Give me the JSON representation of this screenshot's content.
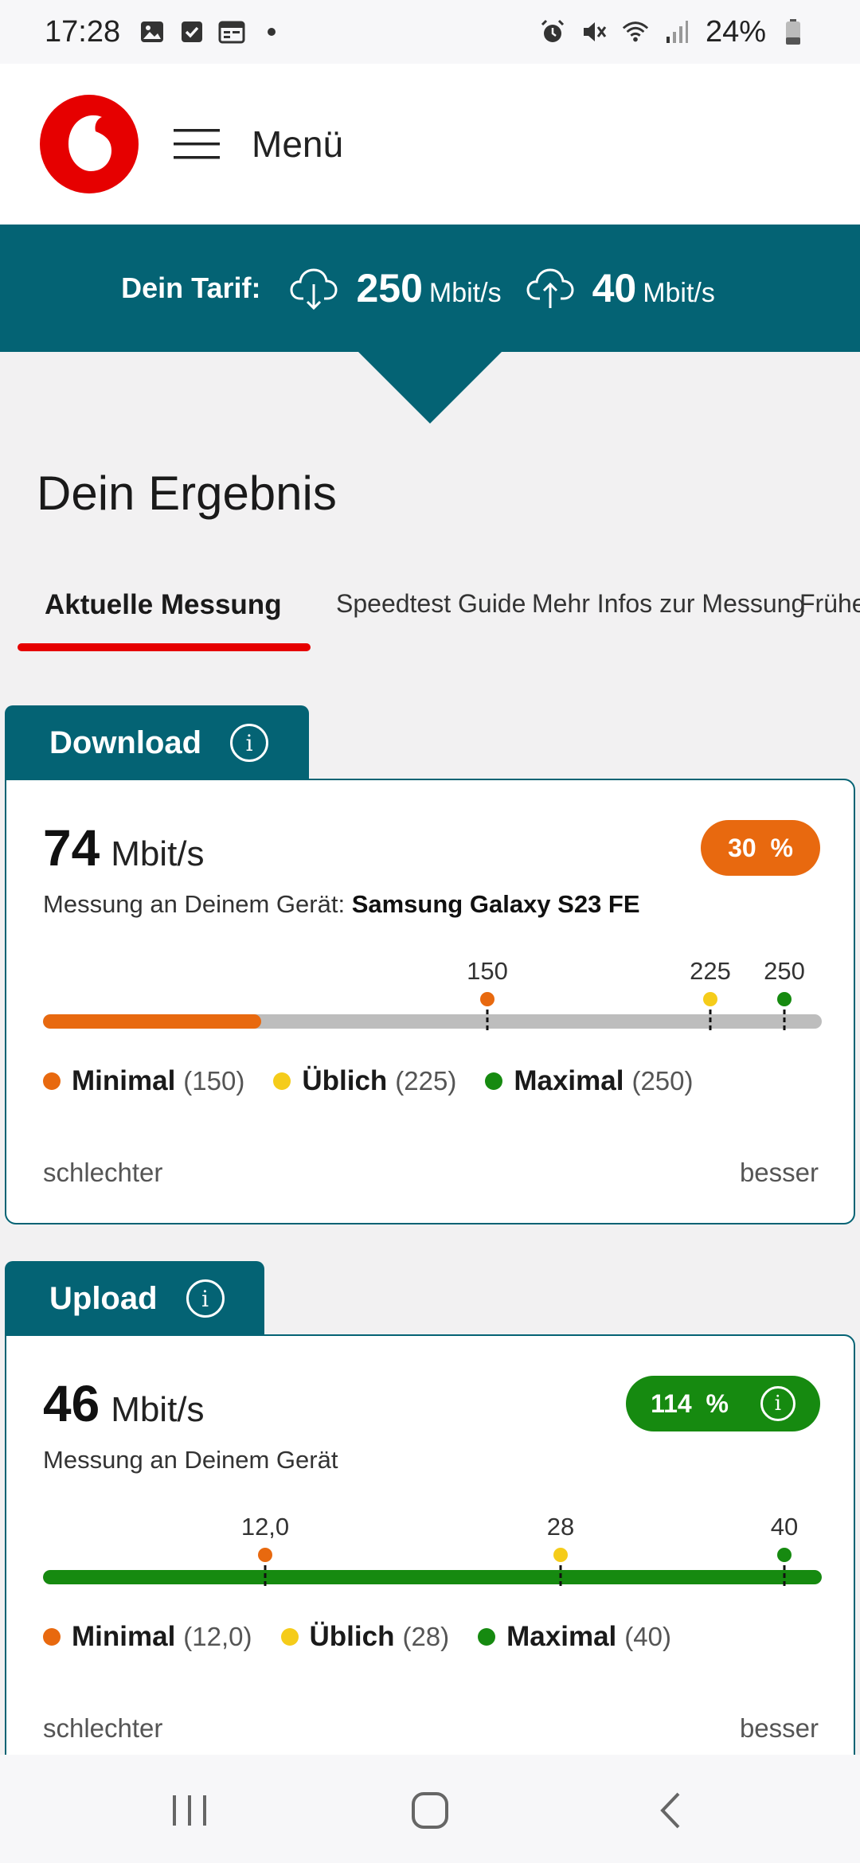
{
  "status_bar": {
    "time": "17:28",
    "left_icons": [
      "image-icon",
      "checkbox-icon",
      "calendar-icon",
      "dot-icon"
    ],
    "right_icons": [
      "alarm-icon",
      "mute-icon",
      "wifi-icon",
      "signal-icon"
    ],
    "battery": "24%"
  },
  "header": {
    "logo": "vodafone-logo",
    "menu_label": "Menü"
  },
  "tariff": {
    "label": "Dein Tarif:",
    "download_value": "250",
    "download_unit": "Mbit/s",
    "upload_value": "40",
    "upload_unit": "Mbit/s"
  },
  "page_title": "Dein Ergebnis",
  "tabs": [
    {
      "label": "Aktuelle Messung",
      "active": true
    },
    {
      "label": "Speedtest Guide",
      "active": false
    },
    {
      "label": "Mehr Infos zur Messung",
      "active": false
    },
    {
      "label": "Frühe",
      "active": false
    }
  ],
  "download": {
    "tab_label": "Download",
    "value": "74",
    "unit": "Mbit/s",
    "percent": "30  %",
    "percent_color": "#e8690f",
    "device_prefix": "Messung an Deinem Gerät:",
    "device_name": "Samsung Galaxy S23 FE",
    "fill_fraction": 0.28,
    "fill_color": "#e8690f",
    "markers": [
      {
        "label": "150",
        "fraction": 0.571,
        "color": "#e8690f"
      },
      {
        "label": "225",
        "fraction": 0.857,
        "color": "#f5cc1a"
      },
      {
        "label": "250",
        "fraction": 0.952,
        "color": "#168a10"
      }
    ],
    "legend": [
      {
        "name": "Minimal",
        "value": "(150)",
        "color": "#e8690f"
      },
      {
        "name": "Üblich",
        "value": "(225)",
        "color": "#f5cc1a"
      },
      {
        "name": "Maximal",
        "value": "(250)",
        "color": "#168a10"
      }
    ],
    "scale_left": "schlechter",
    "scale_right": "besser"
  },
  "upload": {
    "tab_label": "Upload",
    "value": "46",
    "unit": "Mbit/s",
    "percent": "114  %",
    "percent_color": "#168a10",
    "device_prefix": "Messung an Deinem Gerät",
    "fill_fraction": 1.0,
    "fill_color": "#168a10",
    "markers": [
      {
        "label": "12,0",
        "fraction": 0.285,
        "color": "#e8690f"
      },
      {
        "label": "28",
        "fraction": 0.665,
        "color": "#f5cc1a"
      },
      {
        "label": "40",
        "fraction": 0.952,
        "color": "#168a10"
      }
    ],
    "legend": [
      {
        "name": "Minimal",
        "value": "(12,0)",
        "color": "#e8690f"
      },
      {
        "name": "Üblich",
        "value": "(28)",
        "color": "#f5cc1a"
      },
      {
        "name": "Maximal",
        "value": "(40)",
        "color": "#168a10"
      }
    ],
    "scale_left": "schlechter",
    "scale_right": "besser"
  },
  "nav": [
    "recents-icon",
    "home-icon",
    "back-icon"
  ],
  "colors": {
    "brand_red": "#e60000",
    "teal": "#046374"
  }
}
